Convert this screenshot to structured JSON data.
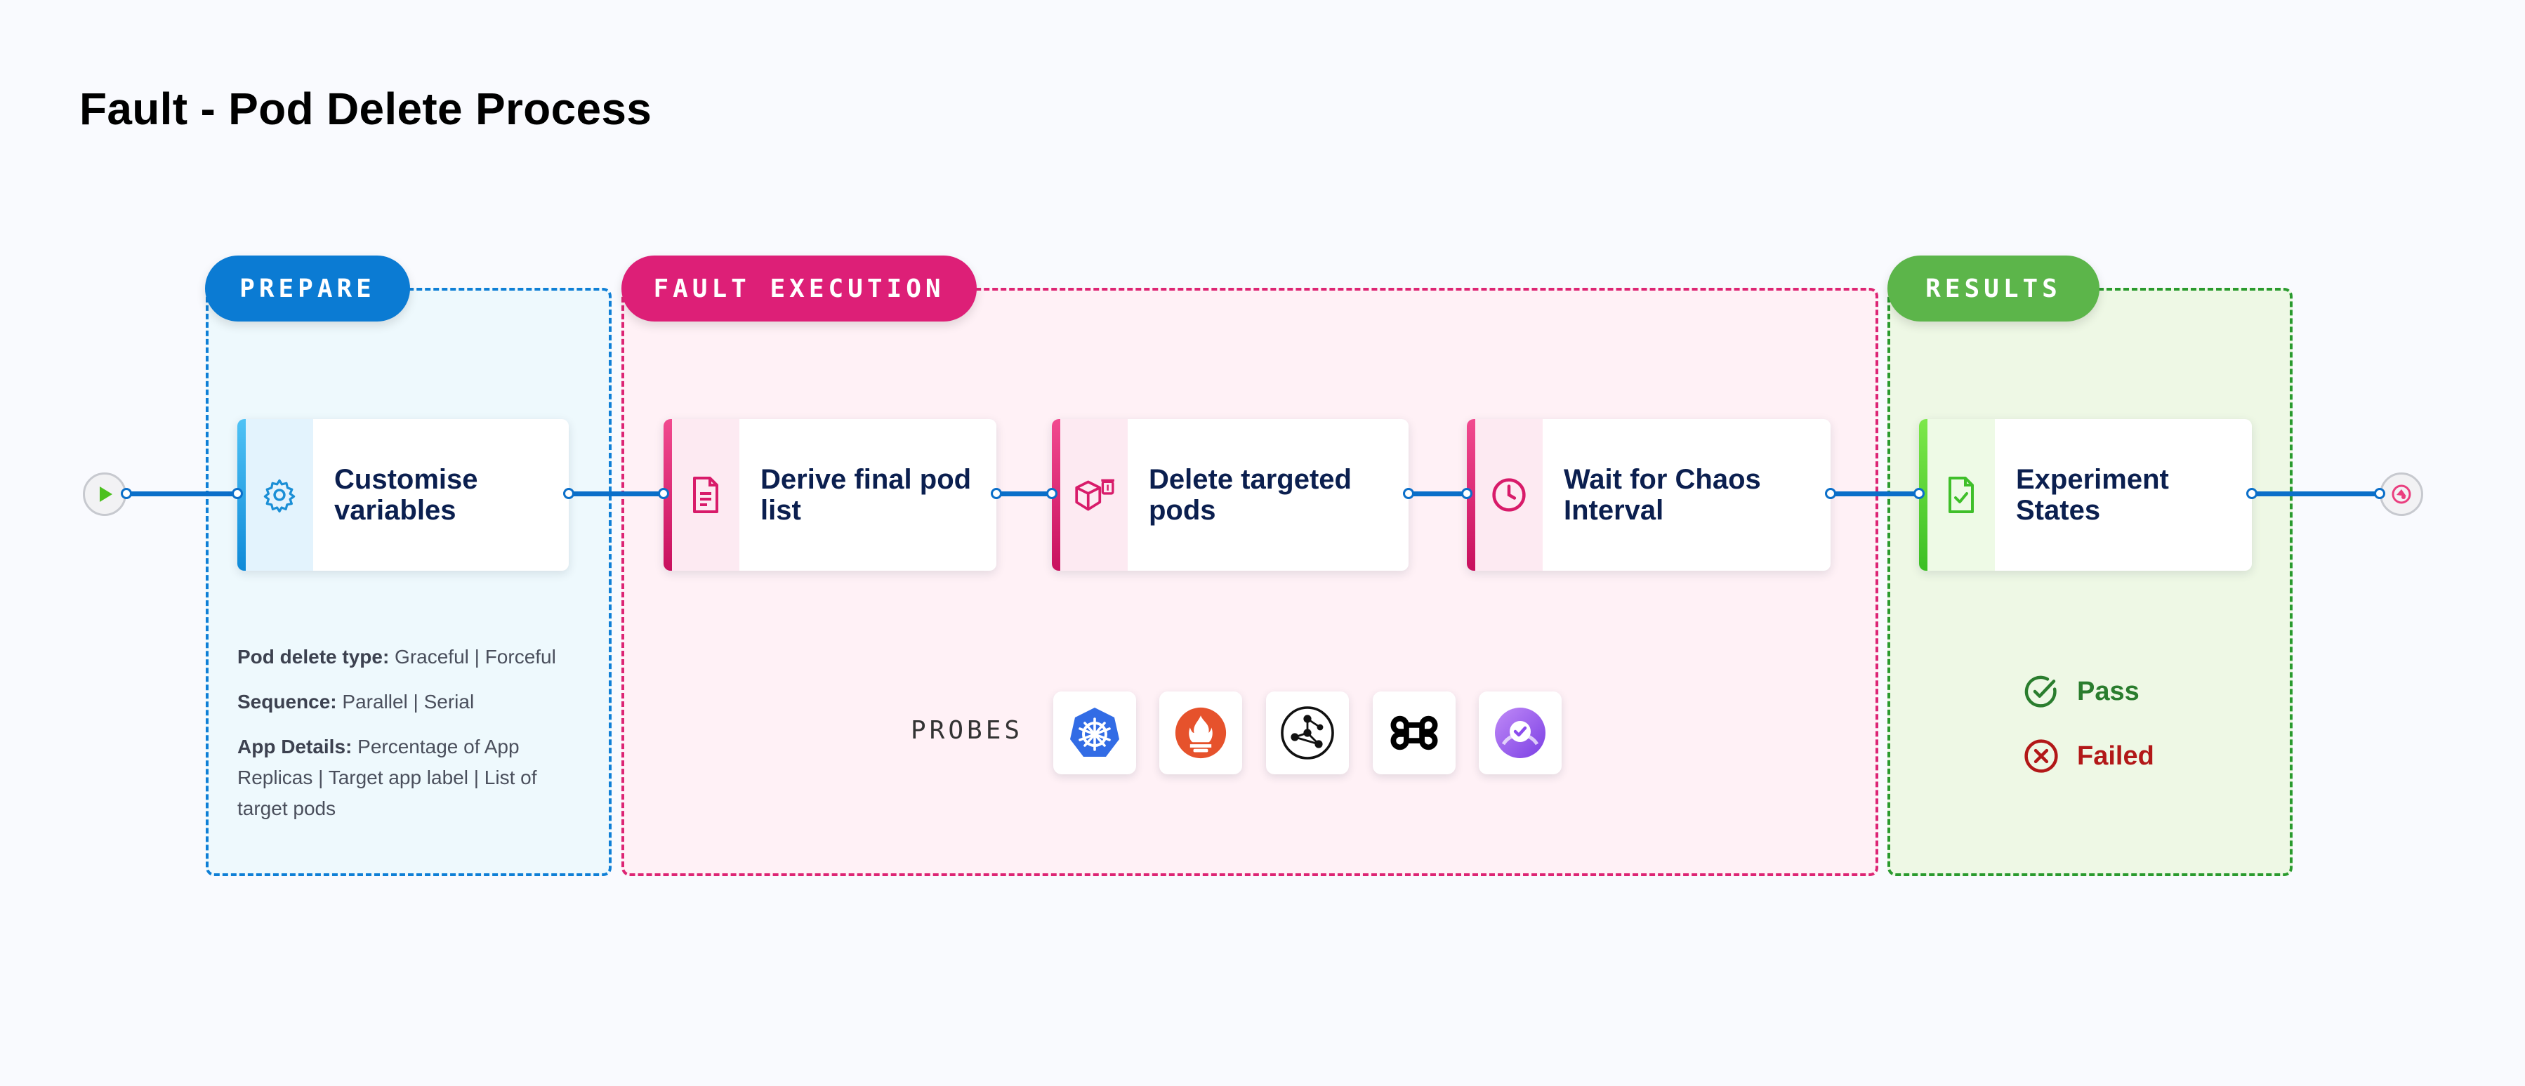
{
  "title": "Fault - Pod Delete Process",
  "sections": {
    "prepare": {
      "label": "PREPARE",
      "color": "#0b7bd3"
    },
    "fault_execution": {
      "label": "FAULT EXECUTION",
      "color": "#dd1f77"
    },
    "results": {
      "label": "RESULTS",
      "color": "#5cb54a"
    }
  },
  "steps": [
    {
      "label": "Customise variables",
      "icon": "gear-icon"
    },
    {
      "label": "Derive final pod list",
      "icon": "document-icon"
    },
    {
      "label": "Delete targeted pods",
      "icon": "cube-delete-icon"
    },
    {
      "label": "Wait for Chaos Interval",
      "icon": "clock-icon"
    },
    {
      "label": "Experiment States",
      "icon": "file-check-icon"
    }
  ],
  "prepare_details": [
    {
      "key": "Pod delete type:",
      "value": " Graceful | Forceful"
    },
    {
      "key": "Sequence:",
      "value": " Parallel | Serial"
    },
    {
      "key": "App Details:",
      "value": " Percentage of App Replicas | Target app label | List of target pods"
    }
  ],
  "probes": {
    "label": "PROBES",
    "items": [
      "kubernetes-icon",
      "prometheus-icon",
      "network-graph-icon",
      "command-icon",
      "chaos-check-icon"
    ]
  },
  "results": [
    {
      "label": "Pass",
      "color": "#2a7d2e",
      "icon": "check-circle-icon"
    },
    {
      "label": "Failed",
      "color": "#b21818",
      "icon": "x-circle-icon"
    }
  ]
}
